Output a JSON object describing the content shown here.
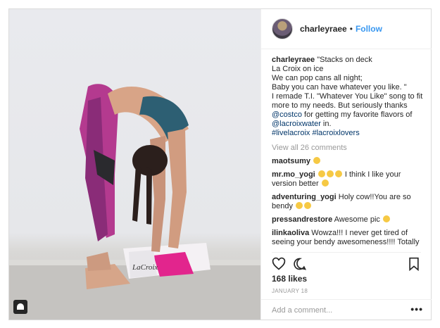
{
  "post": {
    "username": "charleyraee",
    "separator": "•",
    "follow_label": "Follow",
    "caption_user": "charleyraee",
    "caption_text": " \"Stacks on deck\nLa Croix on ice\nWe can pop cans all night;\nBaby you can have whatever you like. \"\nI remade T.I. \"Whatever You Like\" song to fit more to my needs. But seriously thanks ",
    "mention_costco": "@costco",
    "caption_mid": " for getting my favorite flavors of ",
    "mention_lacroix": "@lacroixwater",
    "caption_end": " in.",
    "hashtags": "#livelacroix #lacroixlovers",
    "view_all": "View all 26 comments",
    "comments": [
      {
        "user": "maotsumy",
        "text": ""
      },
      {
        "user": "mr.mo_yogi",
        "text": "I think I like your version better"
      },
      {
        "user": "adventuring_yogi",
        "text": "Holy cow!!You are so bendy"
      },
      {
        "user": "pressandrestore",
        "text": "Awesome pic"
      },
      {
        "user": "ilinkaoliva",
        "text": "Wowza!!! I never get tired of seeing your bendy awesomeness!!!! Totally"
      }
    ],
    "likes": "168 likes",
    "date": "JANUARY 18",
    "add_comment_placeholder": "Add a comment...",
    "more_label": "•••"
  },
  "colors": {
    "link": "#003569",
    "follow": "#3897f0",
    "muted": "#999999"
  },
  "icons": [
    "heart-icon",
    "comment-icon",
    "bookmark-icon",
    "user-tag-icon"
  ]
}
